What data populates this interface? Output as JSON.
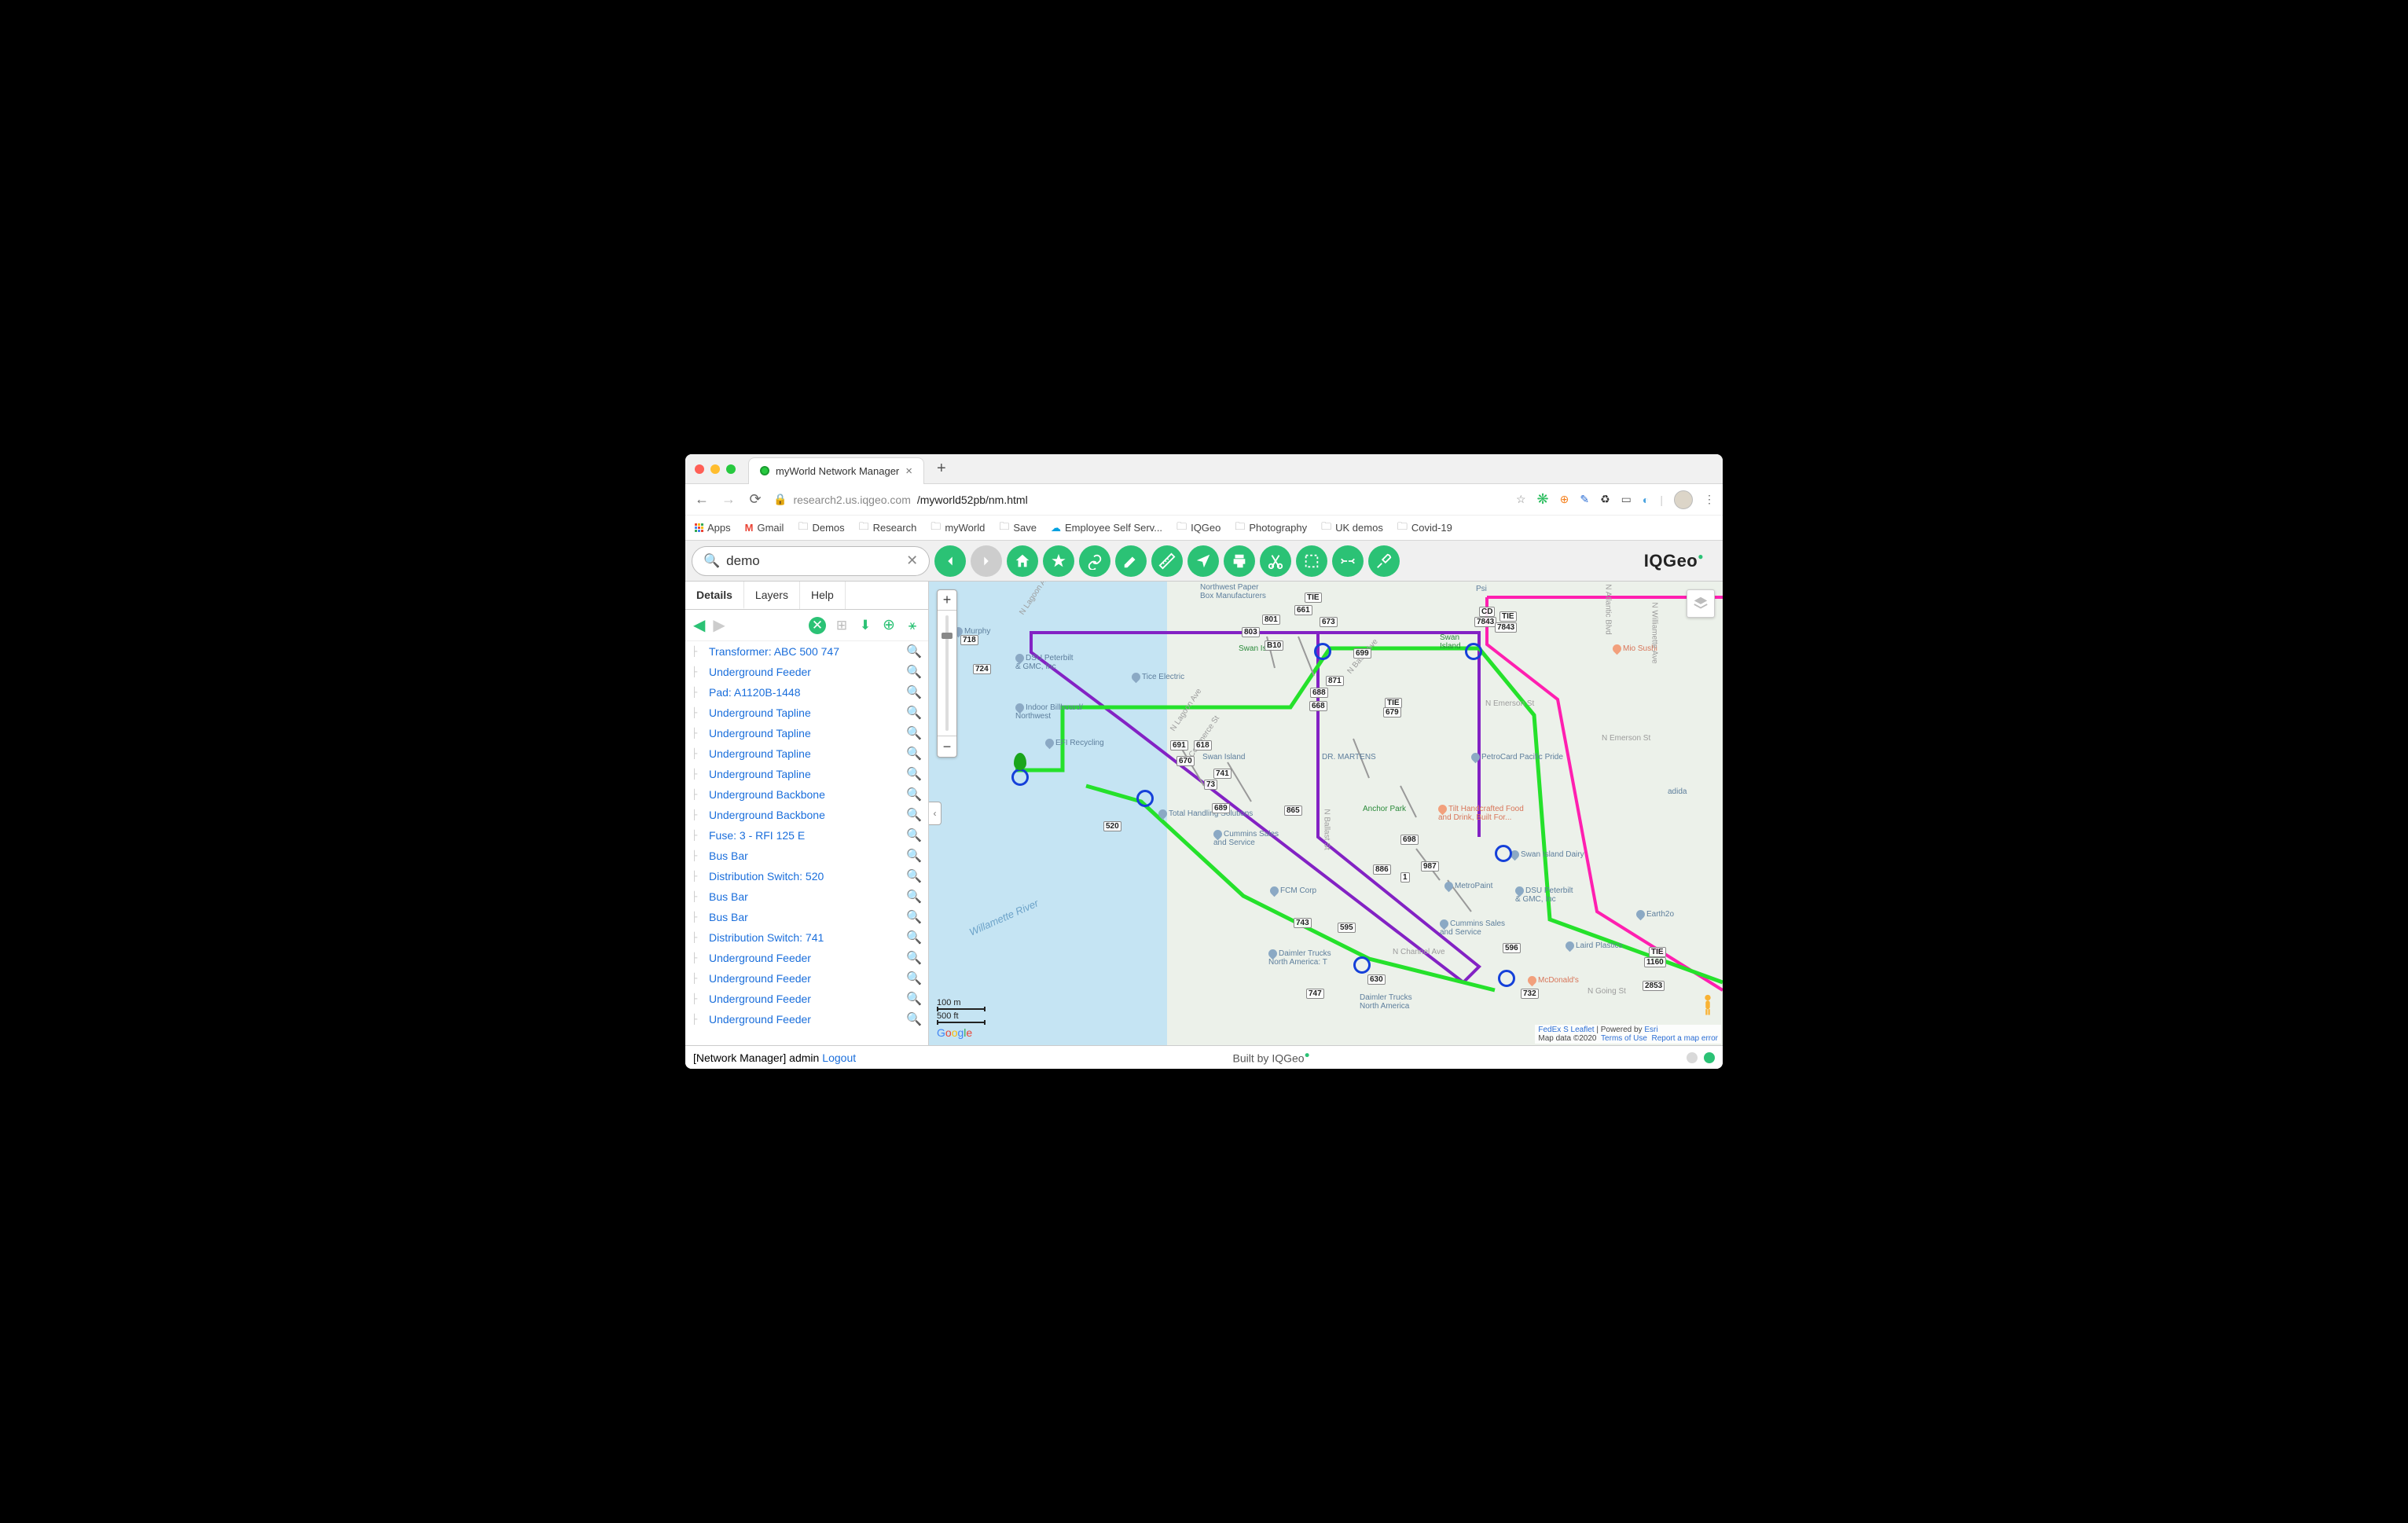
{
  "tab": {
    "title": "myWorld Network Manager"
  },
  "url": {
    "host": "research2.us.iqgeo.com",
    "path": "/myworld52pb/nm.html"
  },
  "bookmarks": [
    "Apps",
    "Gmail",
    "Demos",
    "Research",
    "myWorld",
    "Save",
    "Employee Self Serv...",
    "IQGeo",
    "Photography",
    "UK demos",
    "Covid-19"
  ],
  "search": {
    "value": "demo"
  },
  "logo": "IQGeo",
  "panel": {
    "tabs": [
      "Details",
      "Layers",
      "Help"
    ],
    "activeTab": 0,
    "items": [
      "Transformer: ABC 500 747",
      "Underground Feeder",
      "Pad: A1120B-1448",
      "Underground Tapline",
      "Underground Tapline",
      "Underground Tapline",
      "Underground Tapline",
      "Underground Backbone",
      "Underground Backbone",
      "Fuse: 3 - RFI 125 E",
      "Bus Bar",
      "Distribution Switch: 520",
      "Bus Bar",
      "Bus Bar",
      "Distribution Switch: 741",
      "Underground Feeder",
      "Underground Feeder",
      "Underground Feeder",
      "Underground Feeder"
    ]
  },
  "map": {
    "scale_m": "100 m",
    "scale_ft": "500 ft",
    "attribution": {
      "left": "FedEx S",
      "leaflet": "Leaflet",
      "powered": "Powered by",
      "esri": "Esri",
      "copyright": "Map data ©2020",
      "terms": "Terms of Use",
      "report": "Report a map error"
    },
    "poles": [
      "718",
      "724",
      "B10",
      "803",
      "801",
      "673",
      "661",
      "CD",
      "7843",
      "TIE 7843",
      "699",
      "871",
      "688",
      "691",
      "618",
      "TIE 679",
      "670",
      "741",
      "73",
      "689",
      "865",
      "668",
      "520",
      "743",
      "698",
      "987",
      "886",
      "1",
      "595",
      "TIE 1160",
      "2853",
      "630",
      "747",
      "732",
      "596",
      "TIE"
    ],
    "pois": [
      "Northwest Paper Box Manufacturers",
      "Psi",
      "Murphy",
      "DSU Peterbilt & GMC, Inc",
      "Tice Electric",
      "Swan Island",
      "Swan Island",
      "Mio Sushi",
      "Indoor Billboard/Northwest",
      "EFI Recycling",
      "DR. MARTENS",
      "PetroCard Pacific Pride",
      "adida",
      "Total Handling Solutions",
      "Anchor Park",
      "Tilt Handcrafted Food and Drink, Built For...",
      "Cummins Sales and Service",
      "Swan Island Dairy",
      "MetroPaint",
      "DSU Peterbilt & GMC, Inc",
      "FCM Corp",
      "Earth2o",
      "Cummins Sales and Service",
      "Laird Plastics",
      "Daimler Trucks North America: T",
      "McDonald's",
      "Daimler Trucks North America",
      "Willamette River",
      "N Emerson St",
      "N Emerson St",
      "N Lagoon Ave",
      "N Lagoon Ave",
      "N Commerce St",
      "N Ballast St",
      "N Basin Ave",
      "N Channel Ave",
      "N Going St",
      "N Atlantic Blvd",
      "N Williamette Ave"
    ]
  },
  "status": {
    "left_prefix": "[Network Manager] admin ",
    "logout": "Logout",
    "center": "Built by IQGeo"
  }
}
